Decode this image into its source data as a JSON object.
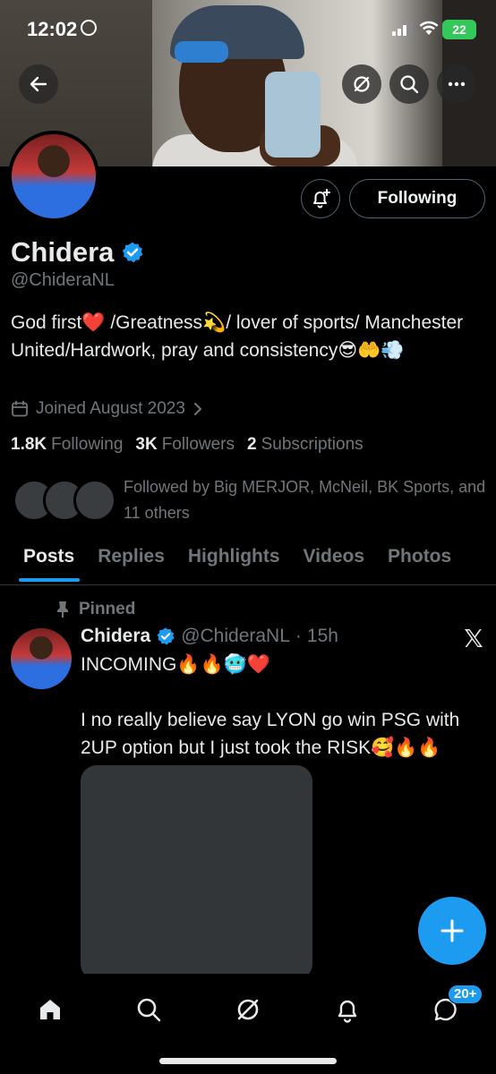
{
  "status_bar": {
    "time": "12:02",
    "battery": "22"
  },
  "profile": {
    "name": "Chidera",
    "handle": "@ChideraNL",
    "follow_button": "Following",
    "bio": "God first❤️ /Greatness💫/ lover of sports/ Manchester United/Hardwork, pray and consistency😎🤲💨",
    "joined": "Joined August 2023",
    "stats": [
      {
        "count": "1.8K",
        "label": "Following"
      },
      {
        "count": "3K",
        "label": "Followers"
      },
      {
        "count": "2",
        "label": "Subscriptions"
      }
    ],
    "followed_by": "Followed by Big MERJOR, McNeil, BK Sports, and 11 others"
  },
  "tabs": [
    "Posts",
    "Replies",
    "Highlights",
    "Videos",
    "Photos"
  ],
  "active_tab": "Posts",
  "tweet": {
    "pinned_label": "Pinned",
    "name": "Chidera",
    "handle": "@ChideraNL",
    "separator": "·",
    "time": "15h",
    "text": "INCOMING🔥🔥🥶❤️\n\nI no really believe say LYON go win PSG with 2UP option but I just took the RISK🥰🔥🔥"
  },
  "bottom_nav": {
    "items": [
      "home-icon",
      "search-icon",
      "grok-icon",
      "notifications-icon",
      "messages-icon"
    ],
    "messages_badge": "20+"
  },
  "colors": {
    "accent": "#1d9bf0",
    "muted": "#71767b",
    "background": "#000000"
  }
}
